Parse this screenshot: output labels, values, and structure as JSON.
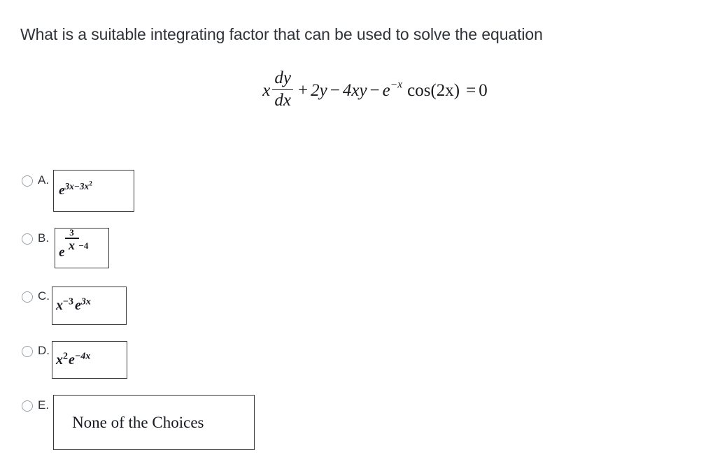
{
  "question": {
    "prompt": "What is a suitable integrating factor that can be used to solve the equation",
    "equation_plain": "x dy/dx + 2y - 4xy - e^(-x) cos(2x) = 0",
    "equation": {
      "lead_variable": "x",
      "fraction_numerator": "dy",
      "fraction_denominator": "dx",
      "term_plus": "+",
      "term_2y": "2y",
      "minus_1": "−",
      "term_4xy": "4xy",
      "minus_2": "−",
      "exp_base": "e",
      "exp_power": "−x",
      "cos_name": "cos",
      "cos_arg": "(2x)",
      "equals": "=",
      "rhs": "0"
    }
  },
  "choices": [
    {
      "id": "a",
      "letter": "A.",
      "selected": false,
      "value_plain": "e^(3x-3x^2)",
      "parts": {
        "base": "e",
        "exp_main": "3x−3x",
        "exp_sup": "2"
      }
    },
    {
      "id": "b",
      "letter": "B.",
      "selected": false,
      "value_plain": "e^(3/x - 4)",
      "parts": {
        "base": "e",
        "frac_num": "3",
        "frac_den": "x",
        "trailing": "−4"
      }
    },
    {
      "id": "c",
      "letter": "C.",
      "selected": false,
      "value_plain": "x^(-3) e^(3x)",
      "parts": {
        "base1": "x",
        "exp1": "−3",
        "base2": "e",
        "exp2": "3x"
      }
    },
    {
      "id": "d",
      "letter": "D.",
      "selected": false,
      "value_plain": "x^2 e^(-4x)",
      "parts": {
        "base1": "x",
        "exp1": "2",
        "base2": "e",
        "exp2": "−4x"
      }
    },
    {
      "id": "e",
      "letter": "E.",
      "selected": false,
      "value_plain": "None of the Choices",
      "parts": {
        "text": "None of the Choices"
      }
    }
  ],
  "colors": {
    "page_background": "#ffffff",
    "question_text": "#2f3338",
    "math_text": "#16181f",
    "box_border": "#3a3a3a",
    "radio_border": "#9aa0a6"
  }
}
